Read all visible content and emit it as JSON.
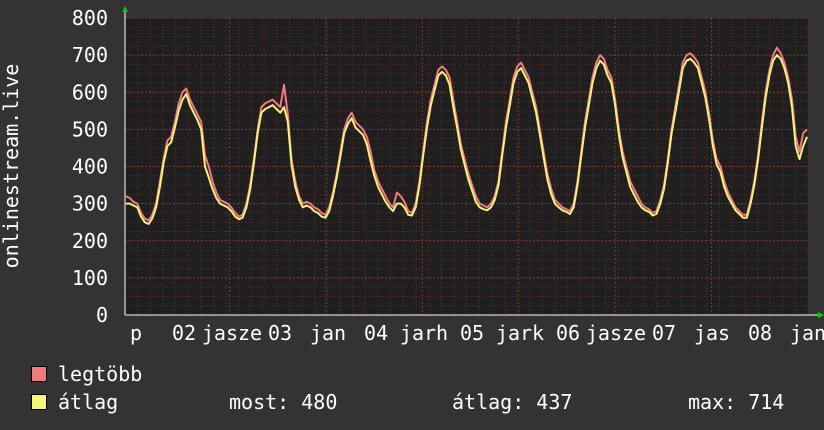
{
  "colors": {
    "background": "#333333",
    "plot_background": "#1f1f1f",
    "grid_minor": "#5a2f2f",
    "grid_major": "#7a3434",
    "axis": "#ffffff",
    "arrow": "#00cc00",
    "max_series": "#f07a80",
    "avg_series": "#f7f27a"
  },
  "chart_data": {
    "type": "line",
    "ylabel": "onlinestream.live",
    "ylim": [
      0,
      800
    ],
    "y_ticks": [
      "0",
      "100",
      "200",
      "300",
      "400",
      "500",
      "600",
      "700",
      "800"
    ],
    "x_ticks": [
      "p",
      "02",
      "jasze",
      "03",
      "jan",
      "04",
      "jarh",
      "05",
      "jark",
      "06",
      "jasze",
      "07",
      "jas",
      "08",
      "jan"
    ],
    "grid": true,
    "series": [
      {
        "name": "legtöbb",
        "color": "#f07a80",
        "values": [
          320,
          315,
          305,
          300,
          275,
          260,
          255,
          270,
          300,
          360,
          420,
          470,
          480,
          520,
          570,
          600,
          610,
          580,
          560,
          540,
          520,
          430,
          400,
          360,
          330,
          310,
          305,
          300,
          290,
          275,
          265,
          270,
          300,
          350,
          420,
          500,
          560,
          570,
          575,
          580,
          570,
          560,
          620,
          540,
          420,
          360,
          320,
          300,
          305,
          300,
          290,
          285,
          275,
          270,
          290,
          330,
          380,
          440,
          500,
          530,
          545,
          520,
          510,
          500,
          480,
          440,
          390,
          360,
          340,
          320,
          300,
          290,
          330,
          320,
          305,
          280,
          275,
          300,
          360,
          440,
          520,
          580,
          620,
          660,
          670,
          660,
          640,
          580,
          520,
          460,
          420,
          380,
          350,
          320,
          300,
          295,
          290,
          300,
          320,
          360,
          440,
          520,
          580,
          640,
          670,
          680,
          660,
          640,
          600,
          560,
          500,
          440,
          380,
          340,
          310,
          300,
          290,
          285,
          280,
          300,
          360,
          440,
          520,
          580,
          640,
          680,
          700,
          690,
          660,
          640,
          580,
          500,
          440,
          400,
          360,
          340,
          320,
          300,
          290,
          285,
          275,
          280,
          310,
          350,
          420,
          500,
          560,
          620,
          680,
          700,
          705,
          695,
          680,
          640,
          600,
          540,
          470,
          420,
          400,
          360,
          330,
          310,
          290,
          280,
          270,
          270,
          310,
          360,
          430,
          520,
          600,
          660,
          700,
          720,
          705,
          680,
          640,
          580,
          480,
          440,
          490,
          500
        ]
      },
      {
        "name": "átlag",
        "color": "#f7f27a",
        "values": [
          300,
          300,
          295,
          290,
          265,
          250,
          245,
          260,
          290,
          345,
          410,
          455,
          465,
          505,
          550,
          580,
          595,
          565,
          545,
          525,
          500,
          400,
          370,
          340,
          315,
          300,
          295,
          290,
          280,
          265,
          258,
          262,
          290,
          340,
          410,
          490,
          545,
          555,
          560,
          565,
          555,
          545,
          560,
          520,
          405,
          345,
          310,
          290,
          295,
          290,
          280,
          275,
          265,
          262,
          280,
          320,
          370,
          430,
          490,
          515,
          530,
          505,
          495,
          485,
          460,
          415,
          375,
          345,
          325,
          305,
          290,
          280,
          300,
          300,
          290,
          270,
          268,
          290,
          350,
          430,
          505,
          565,
          605,
          645,
          655,
          645,
          620,
          560,
          505,
          445,
          405,
          365,
          335,
          305,
          290,
          285,
          282,
          290,
          310,
          350,
          430,
          505,
          565,
          625,
          655,
          665,
          645,
          625,
          585,
          545,
          485,
          425,
          365,
          325,
          300,
          290,
          282,
          278,
          272,
          290,
          350,
          430,
          505,
          565,
          625,
          665,
          685,
          675,
          645,
          625,
          565,
          485,
          425,
          385,
          345,
          325,
          305,
          290,
          282,
          278,
          268,
          272,
          300,
          340,
          410,
          490,
          545,
          605,
          665,
          685,
          690,
          680,
          665,
          625,
          585,
          525,
          455,
          405,
          385,
          345,
          318,
          300,
          282,
          272,
          262,
          262,
          300,
          350,
          420,
          505,
          585,
          645,
          685,
          700,
          690,
          665,
          625,
          560,
          455,
          420,
          455,
          480
        ]
      }
    ]
  },
  "legend": {
    "max_label": "legtöbb",
    "avg_label": "átlag"
  },
  "stats": {
    "now": "most: 480",
    "avg": "átlag: 437",
    "max": "max: 714"
  }
}
